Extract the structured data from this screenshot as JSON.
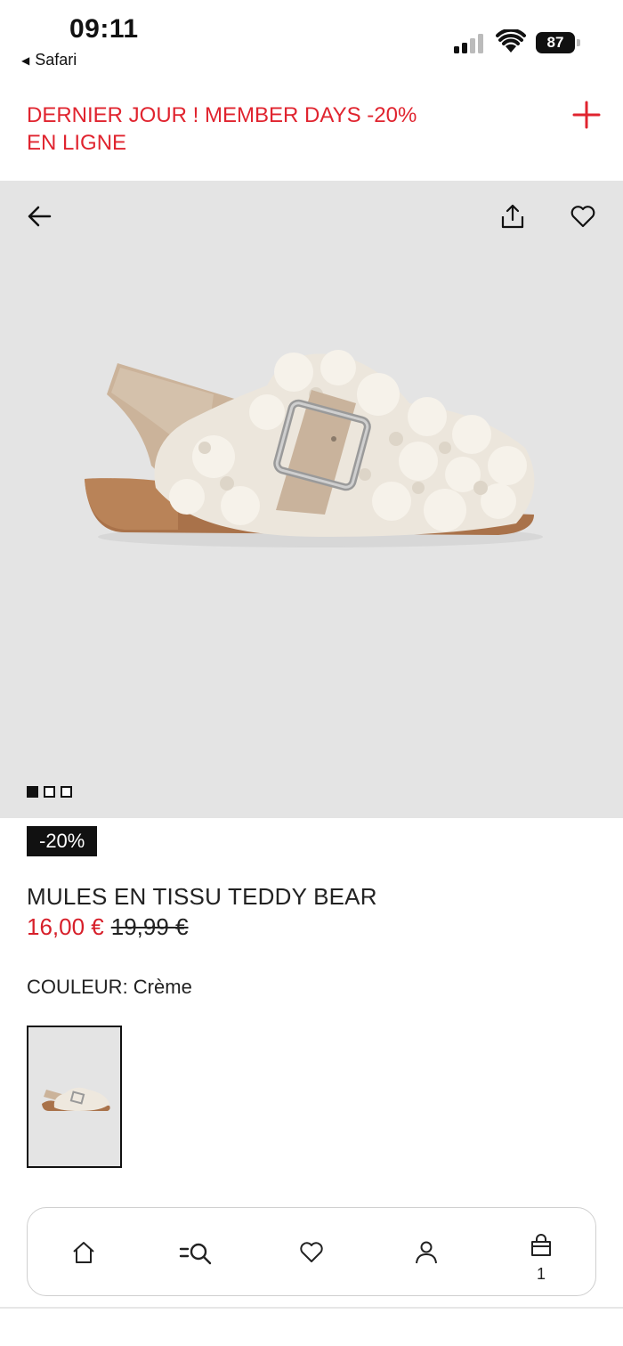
{
  "status_bar": {
    "time": "09:11",
    "back_app": "Safari",
    "battery": "87"
  },
  "promo": {
    "line1": "DERNIER JOUR ! MEMBER DAYS -20%",
    "line2": "EN LIGNE",
    "color": "#e0242f"
  },
  "hero": {
    "icons": [
      "back-arrow-icon",
      "share-icon",
      "heart-icon"
    ],
    "background": "#e4e4e4",
    "image_count": 3,
    "active_image": 1
  },
  "product": {
    "badge": "-20%",
    "name": "MULES EN TISSU TEDDY BEAR",
    "price_now": "16,00 €",
    "price_old": "19,99 €",
    "color_label": "COULEUR: Crème",
    "price_color": "#d71f2a"
  },
  "bottom_nav": {
    "items": [
      "home-icon",
      "search-menu-icon",
      "heart-icon",
      "account-icon",
      "bag-icon"
    ],
    "cart_count": "1"
  }
}
